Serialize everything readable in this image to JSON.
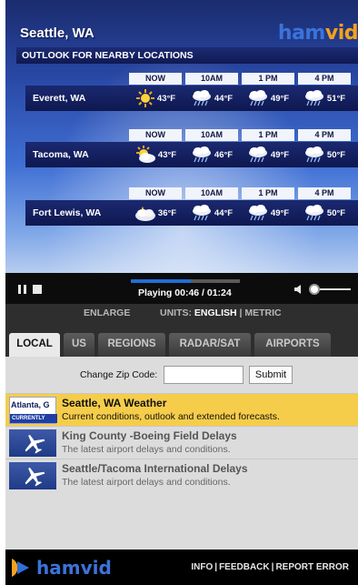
{
  "player": {
    "city_title": "Seattle, WA",
    "brand_part1": "ham",
    "brand_part2": "vid",
    "outlook_title": "OUTLOOK FOR NEARBY LOCATIONS",
    "hour_labels": [
      "NOW",
      "10AM",
      "1 PM",
      "4 PM"
    ],
    "locations": [
      {
        "name": "Everett, WA",
        "temps": [
          "43°F",
          "44°F",
          "49°F",
          "51°F"
        ],
        "icons": [
          "sun-icon",
          "rain-cloud-icon",
          "rain-cloud-icon",
          "rain-cloud-icon"
        ]
      },
      {
        "name": "Tacoma, WA",
        "temps": [
          "43°F",
          "46°F",
          "49°F",
          "50°F"
        ],
        "icons": [
          "partly-cloudy-icon",
          "rain-cloud-icon",
          "rain-cloud-icon",
          "rain-cloud-icon"
        ]
      },
      {
        "name": "Fort Lewis, WA",
        "temps": [
          "36°F",
          "44°F",
          "49°F",
          "50°F"
        ],
        "icons": [
          "cloudy-icon",
          "rain-cloud-icon",
          "rain-cloud-icon",
          "rain-cloud-icon"
        ]
      }
    ]
  },
  "controls": {
    "playing_text": "Playing  00:46 / 01:24",
    "progress_fraction": 0.548
  },
  "units_bar": {
    "enlarge": "ENLARGE",
    "units_label": "UNITS: ",
    "english": "ENGLISH",
    "divider": " | ",
    "metric": "METRIC"
  },
  "tabs": [
    {
      "label": "LOCAL",
      "active": true
    },
    {
      "label": "US",
      "active": false
    },
    {
      "label": "REGIONS",
      "active": false
    },
    {
      "label": "RADAR/SAT",
      "active": false
    },
    {
      "label": "AIRPORTS",
      "active": false
    }
  ],
  "zip": {
    "label": "Change Zip Code:",
    "value": "",
    "submit": "Submit"
  },
  "list": [
    {
      "title": "Seattle, WA Weather",
      "desc": "Current conditions, outlook and extended forecasts.",
      "thumb_city": "Atlanta, G",
      "thumb_label": "CURRENTLY",
      "thumb_icon": "weather-thumb"
    },
    {
      "title": "King County -Boeing Field Delays",
      "desc": "The latest airport delays and conditions.",
      "thumb_icon": "airplane-icon"
    },
    {
      "title": "Seattle/Tacoma International Delays",
      "desc": "The latest airport delays and conditions.",
      "thumb_icon": "airplane-icon"
    }
  ],
  "footer": {
    "brand": "hamvid",
    "links": [
      "INFO",
      "FEEDBACK",
      "REPORT ERROR"
    ]
  },
  "colors": {
    "accent_blue": "#3b73d9",
    "accent_orange": "#f4a21a",
    "selected_row": "#f6cd4a"
  }
}
